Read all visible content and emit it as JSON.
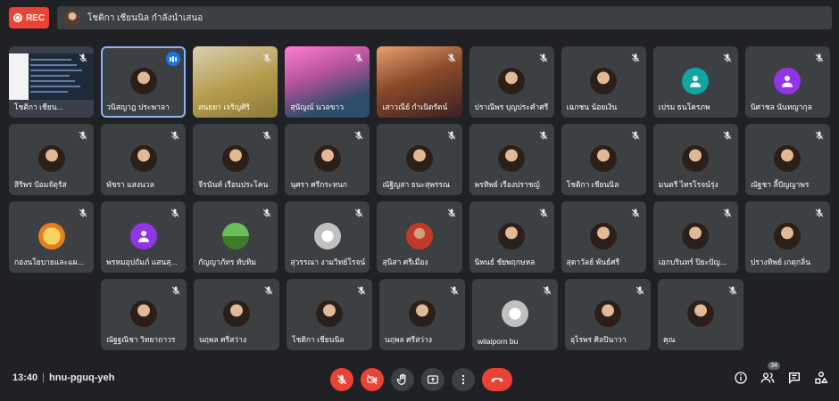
{
  "rec_label": "REC",
  "presenting_text": "โชติกา เชียนนิล กำลังนำเสนอ",
  "meeting_time": "13:40",
  "meeting_code": "hnu-pguq-yeh",
  "participant_count": "34",
  "accent": "#8ab4f8",
  "danger": "#ea4335",
  "rows": [
    [
      {
        "name": "โชติกา เชียน...",
        "kind": "screen"
      },
      {
        "name": "วนิสญาฎ ประพาลา",
        "kind": "avatar",
        "active": true
      },
      {
        "name": "สนยยา เจริญศิริ",
        "kind": "video1"
      },
      {
        "name": "สุนัญณ์ นวลขาว",
        "kind": "video2"
      },
      {
        "name": "เสาวณีย์ กำเนิดรัตน์",
        "kind": "video3"
      },
      {
        "name": "ปราณีพร บุญประคำศรี",
        "kind": "avatar"
      },
      {
        "name": "เฉกชน น้อยเงิน",
        "kind": "avatar"
      },
      {
        "name": "เปรม ธนโครภพ",
        "kind": "green"
      },
      {
        "name": "นิศาชล นันทญากุล",
        "kind": "initial"
      }
    ],
    [
      {
        "name": "สิริพร ป้อมจัตุรัส",
        "kind": "avatar"
      },
      {
        "name": "พัชรา แสงนวล",
        "kind": "avatar"
      },
      {
        "name": "จีรนันท์ เรือนประโคน",
        "kind": "avatar"
      },
      {
        "name": "นุศรา ศรีกระหนก",
        "kind": "avatar"
      },
      {
        "name": "ณัฐิญสา ธนะสุพรรณ",
        "kind": "avatar"
      },
      {
        "name": "พรทิพย์ เรืองปราชญ์",
        "kind": "avatar"
      },
      {
        "name": "โชติกา เชียนนิล",
        "kind": "avatar"
      },
      {
        "name": "มนตรี ไทรโรจน์รุ่ง",
        "kind": "avatar"
      },
      {
        "name": "ณัฐชา ลี้ปัญญาพร",
        "kind": "avatar"
      }
    ],
    [
      {
        "name": "กองนโยบายและแผ...",
        "kind": "img1"
      },
      {
        "name": "พรหมอุปถัมภ์ แสนสุ...",
        "kind": "initial"
      },
      {
        "name": "กัญญาภัทร ทับทิม",
        "kind": "img2"
      },
      {
        "name": "สุวรรณา งามวิทย์โรจน์",
        "kind": "img3"
      },
      {
        "name": "สุนิสา ศรีเมือง",
        "kind": "img4"
      },
      {
        "name": "นิพนธ์ ชัยพฤกษหล",
        "kind": "avatar"
      },
      {
        "name": "สุดาวัลย์ พันธ์ศรี",
        "kind": "avatar"
      },
      {
        "name": "เอกบรินทร์ ปิยะปัญ...",
        "kind": "avatar"
      },
      {
        "name": "ปรางทิพย์ เกตุกลิ่น",
        "kind": "avatar"
      }
    ],
    [
      {
        "name": "ณัฐฐณิชา วิทยาถาวร",
        "kind": "avatar"
      },
      {
        "name": "นฤพล ศรีสว่าง",
        "kind": "avatar"
      },
      {
        "name": "โชติกา เชียนนิล",
        "kind": "avatar"
      },
      {
        "name": "นฤพล ศรีสว่าง",
        "kind": "avatar"
      },
      {
        "name": "wilaiporn bu",
        "kind": "img3"
      },
      {
        "name": "อุไรพร ศิลปินาวา",
        "kind": "avatar"
      },
      {
        "name": "คุณ",
        "kind": "avatar"
      }
    ]
  ]
}
